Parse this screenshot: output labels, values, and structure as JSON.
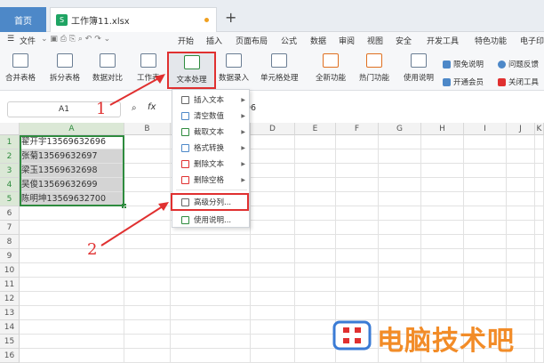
{
  "tabbar": {
    "home": "首页",
    "file_tab": "工作簿11.xlsx",
    "new_tab": "+"
  },
  "menubar": {
    "file_menu": "文件",
    "items": [
      "开始",
      "插入",
      "页面布局",
      "公式",
      "数据",
      "审阅",
      "视图",
      "安全",
      "开发工具",
      "特色功能",
      "电子印"
    ]
  },
  "ribbon": {
    "buttons": [
      "合并表格",
      "拆分表格",
      "数据对比",
      "工作表",
      "文本处理",
      "数据录入",
      "单元格处理",
      "全新功能",
      "热门功能",
      "使用说明"
    ],
    "right_items": [
      "限免说明",
      "问题反馈",
      "开通会员",
      "关闭工具"
    ]
  },
  "formula_bar": {
    "name_box": "A1",
    "fx": "fx",
    "value": "96"
  },
  "grid": {
    "columns": [
      "A",
      "B",
      "C",
      "D",
      "E",
      "F",
      "G",
      "H",
      "I",
      "J",
      "K"
    ],
    "rows": [
      "1",
      "2",
      "3",
      "4",
      "5",
      "6",
      "7",
      "8",
      "9",
      "10",
      "11",
      "12",
      "13",
      "14",
      "15",
      "16"
    ],
    "cells_a": [
      "翟开宇13569632696",
      "张菊13569632697",
      "梁玉13569632698",
      "吴俊13569632699",
      "陈明坤13569632700"
    ]
  },
  "dropdown": {
    "items": [
      "插入文本",
      "清空数值",
      "截取文本",
      "格式转换",
      "删除文本",
      "删除空格",
      "高级分列...",
      "使用说明..."
    ]
  },
  "annotations": {
    "step1": "1",
    "step2": "2"
  },
  "watermark": {
    "text": "电脑技术吧"
  },
  "colors": {
    "accent_red": "#e03030",
    "selection_green": "#2e8b3e",
    "tab_blue": "#4d88c8"
  }
}
